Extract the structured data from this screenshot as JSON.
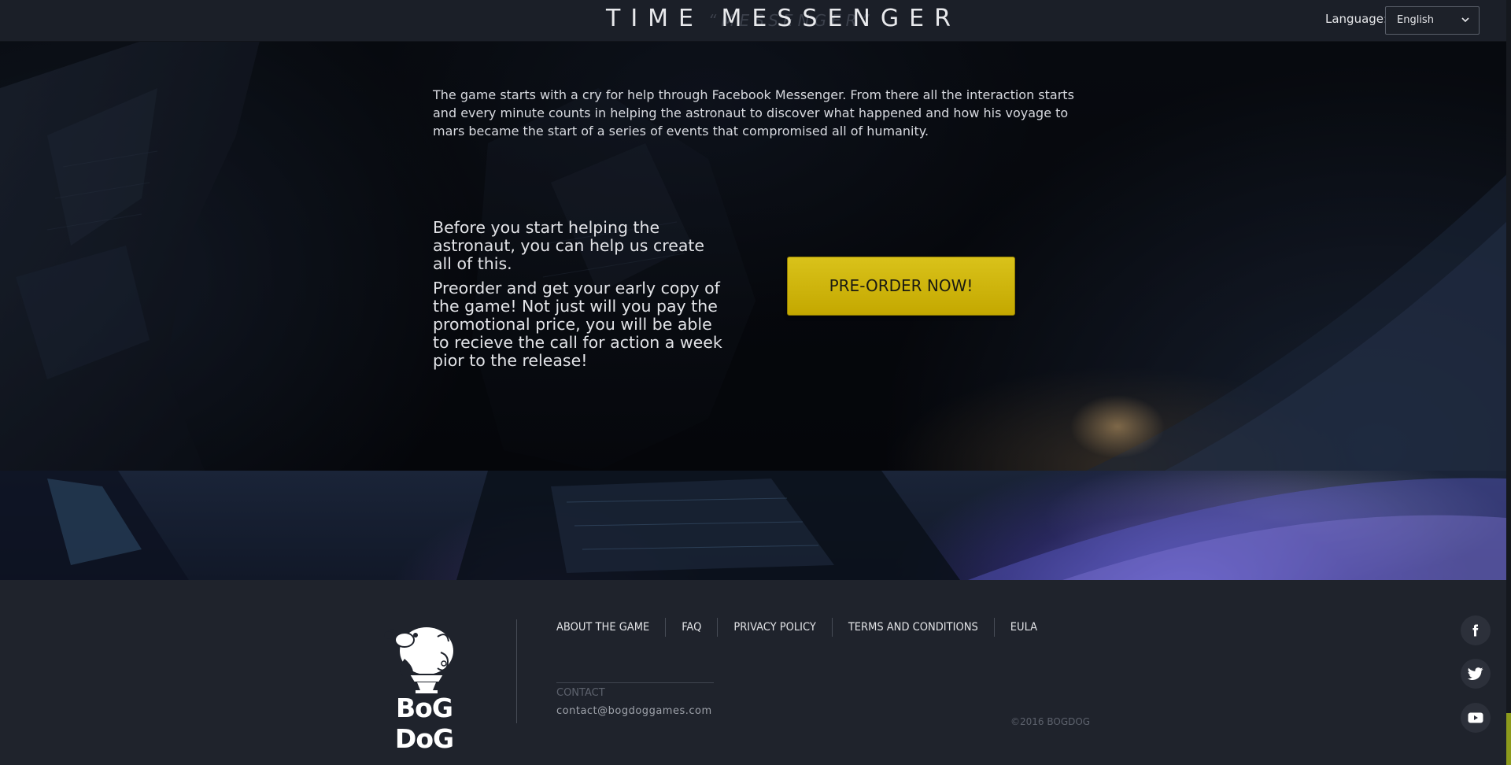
{
  "header": {
    "logo_text": "TIME MESSENGER",
    "logo_ghost_text": "“MESSENGER”",
    "language_label": "Language:",
    "language_selected": "English"
  },
  "hero": {
    "intro": "The game starts with a cry for help through Facebook Messenger. From there all the interaction starts and every minute counts in helping the astronaut to discover what happened and how his voyage to mars became the start of a series of events that compromised all of humanity.",
    "block_a": "Before you start helping the astronaut, you can help us create all of this.",
    "block_b": "Preorder and get your early copy of the game! Not just will you pay the promotional price, you will be able to recieve the call for action a week pior to the release!",
    "preorder_label": "PRE-ORDER NOW!"
  },
  "footer": {
    "brand_name": "BoG DoG",
    "nav": [
      {
        "label": "ABOUT THE GAME"
      },
      {
        "label": "FAQ"
      },
      {
        "label": "PRIVACY POLICY"
      },
      {
        "label": "TERMS AND CONDITIONS"
      },
      {
        "label": "EULA"
      }
    ],
    "contact_label": "CONTACT",
    "contact_email": "contact@bogdoggames.com",
    "copyright": "©2016 BOGDOG",
    "social": [
      {
        "icon": "facebook-icon"
      },
      {
        "icon": "twitter-icon"
      },
      {
        "icon": "youtube-icon"
      }
    ]
  },
  "colors": {
    "header_bg": "#1b1f28",
    "footer_bg": "#1f232c",
    "button_yellow": "#d9c21a",
    "scroll_thumb": "#8c9a1c"
  }
}
